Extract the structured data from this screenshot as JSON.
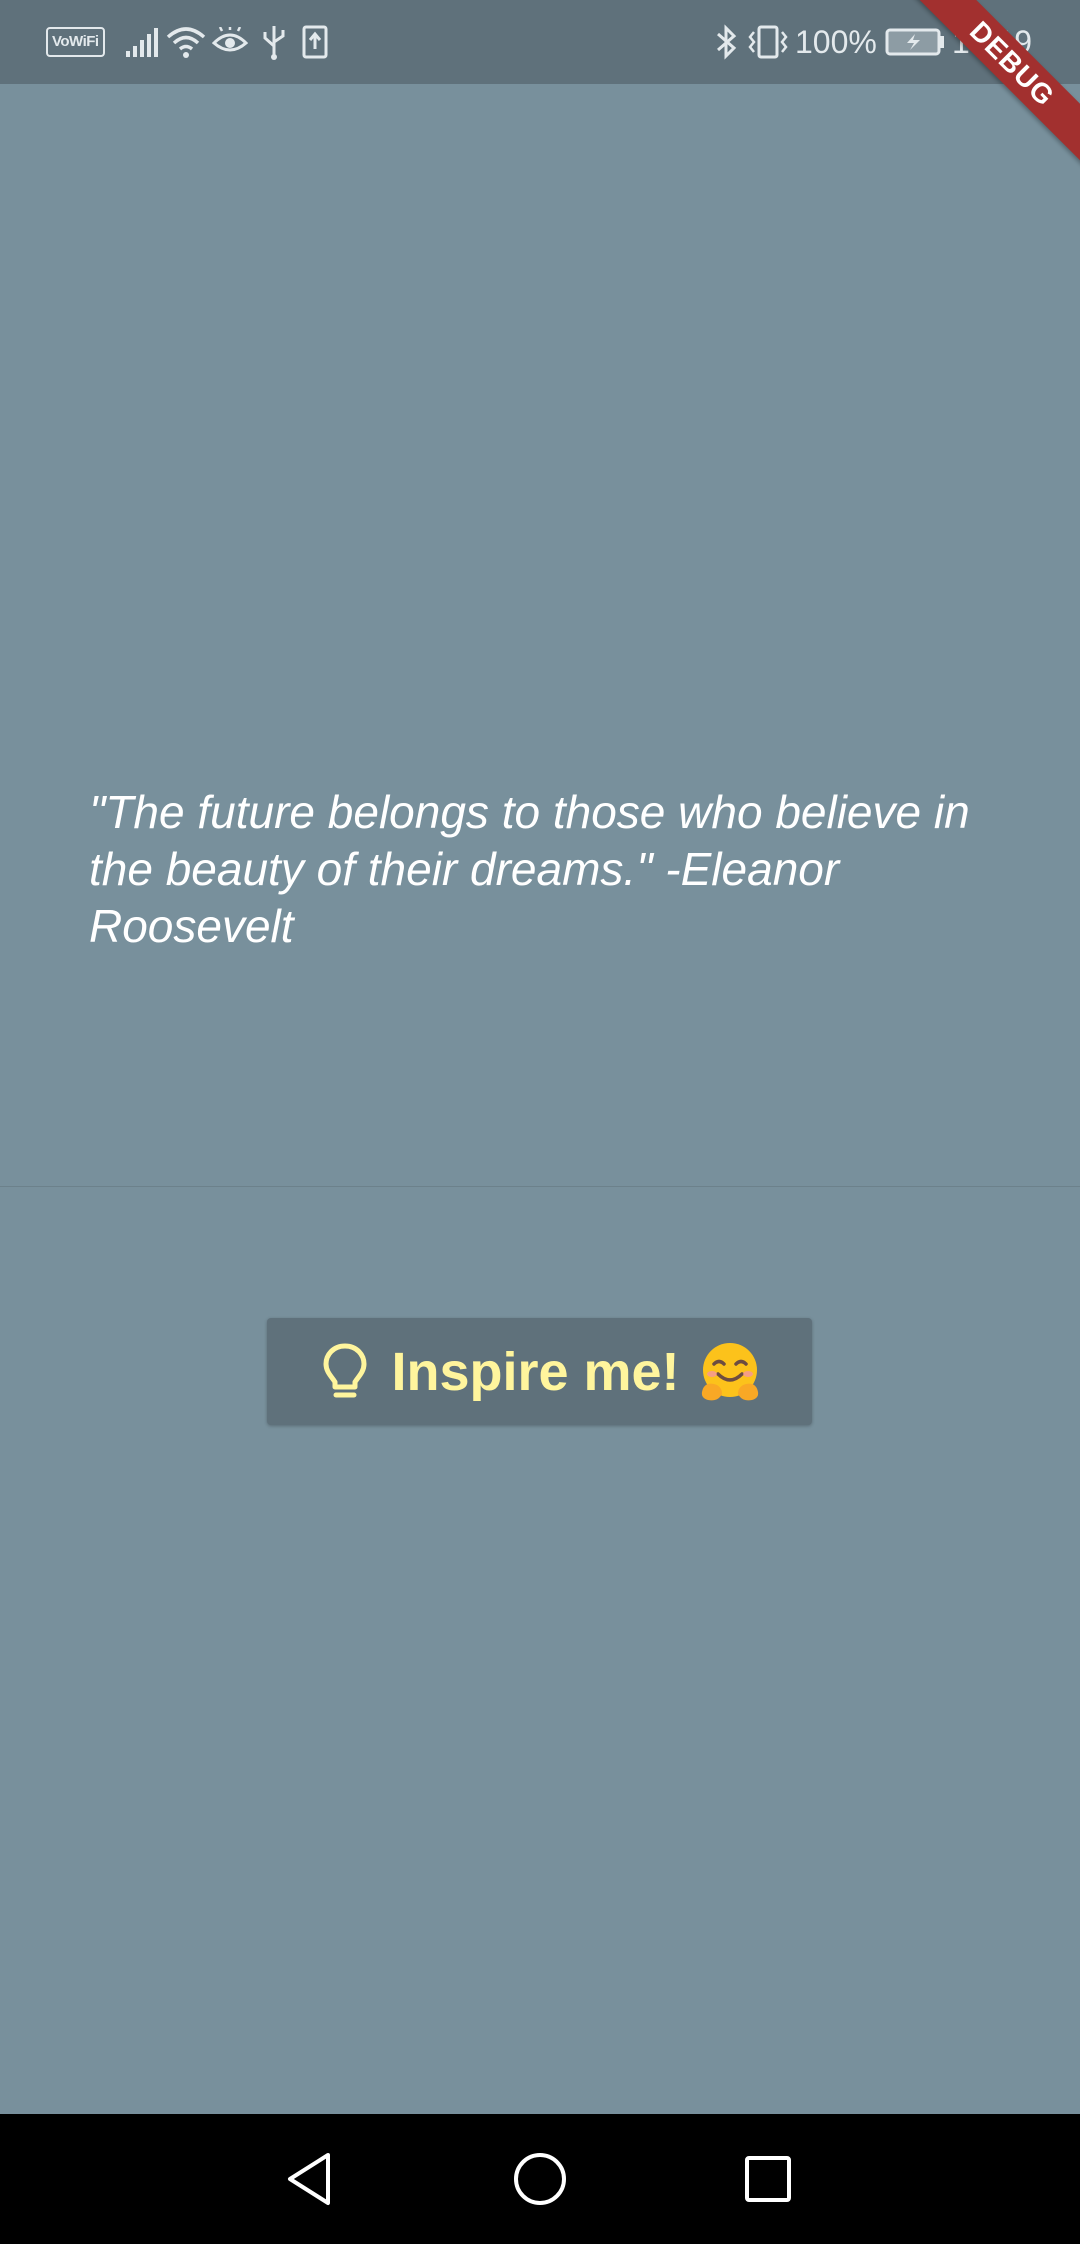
{
  "status_bar": {
    "vowifi_label": "VoWiFi",
    "battery_percent": "100%",
    "time": "17:19",
    "icons": [
      "vowifi-icon",
      "signal-icon",
      "wifi-icon",
      "eye-icon",
      "usb-icon",
      "sim-upload-icon",
      "bluetooth-icon",
      "vibrate-icon",
      "battery-charging-icon"
    ]
  },
  "debug_banner": {
    "label": "DEBUG",
    "color": "#a2302f"
  },
  "quote": {
    "text": "\"The future belongs to those who believe in the beauty of their dreams.\" -Eleanor Roosevelt"
  },
  "inspire_button": {
    "label": "Inspire me!",
    "icon": "lightbulb-icon",
    "emoji": "hugging-face-emoji",
    "text_color": "#fff59d",
    "background": "#5f717b"
  },
  "nav_bar": {
    "buttons": [
      "back-icon",
      "home-icon",
      "recents-icon"
    ]
  },
  "colors": {
    "background": "#78909c",
    "status_bar": "#5f717b"
  }
}
